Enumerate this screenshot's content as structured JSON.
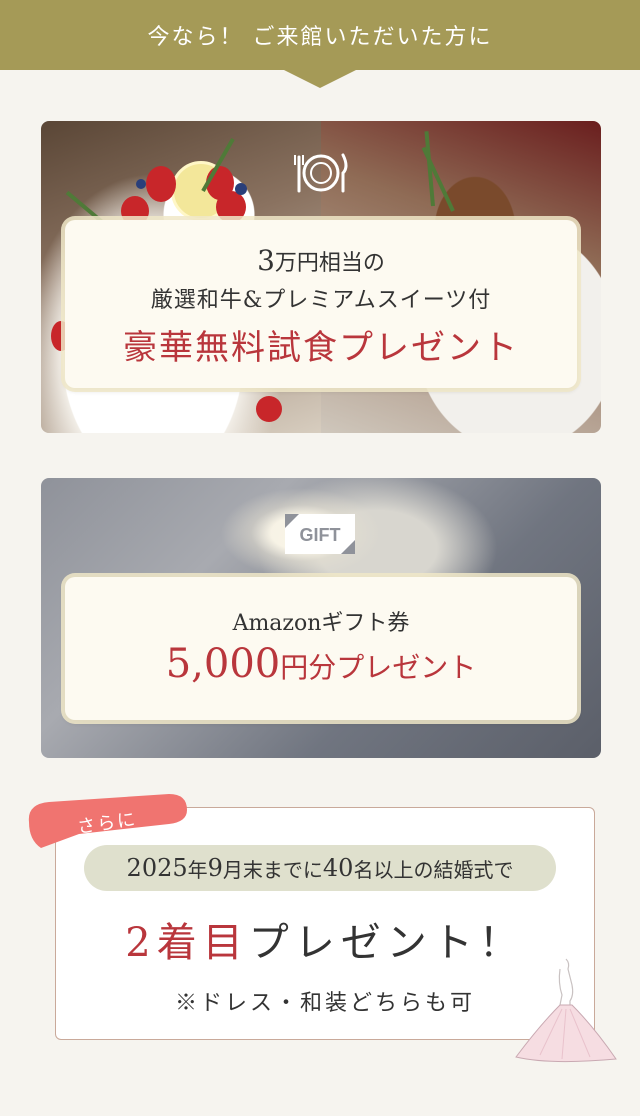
{
  "banner": {
    "text": "今なら！ ご来館いただいた方に"
  },
  "food_offer": {
    "line1_num": "3",
    "line1_rest": "万円相当の",
    "line2": "厳選和牛&プレミアムスイーツ付",
    "line3": "豪華無料試食プレゼント",
    "icon": "dining-plate-icon"
  },
  "gift_offer": {
    "tag": "GIFT",
    "line1": "Amazonギフト券",
    "amount": "5,000",
    "suffix": "円分プレゼント",
    "icon": "gift-tag-icon"
  },
  "extra_offer": {
    "tag": "さらに",
    "condition_num1": "2025",
    "condition_t1": "年",
    "condition_num2": "9",
    "condition_t2": "月末までに",
    "condition_num3": "40",
    "condition_t3": "名以上の結婚式で",
    "title_red": "2着目",
    "title_rest": "プレゼント！",
    "note": "※ドレス・和装どちらも可",
    "icon": "wedding-dress-icon"
  },
  "colors": {
    "banner": "#a59a57",
    "accent_red": "#b9363c",
    "tag_pink": "#f07470",
    "pill": "#dfe0cd",
    "background": "#f6f4ef"
  }
}
